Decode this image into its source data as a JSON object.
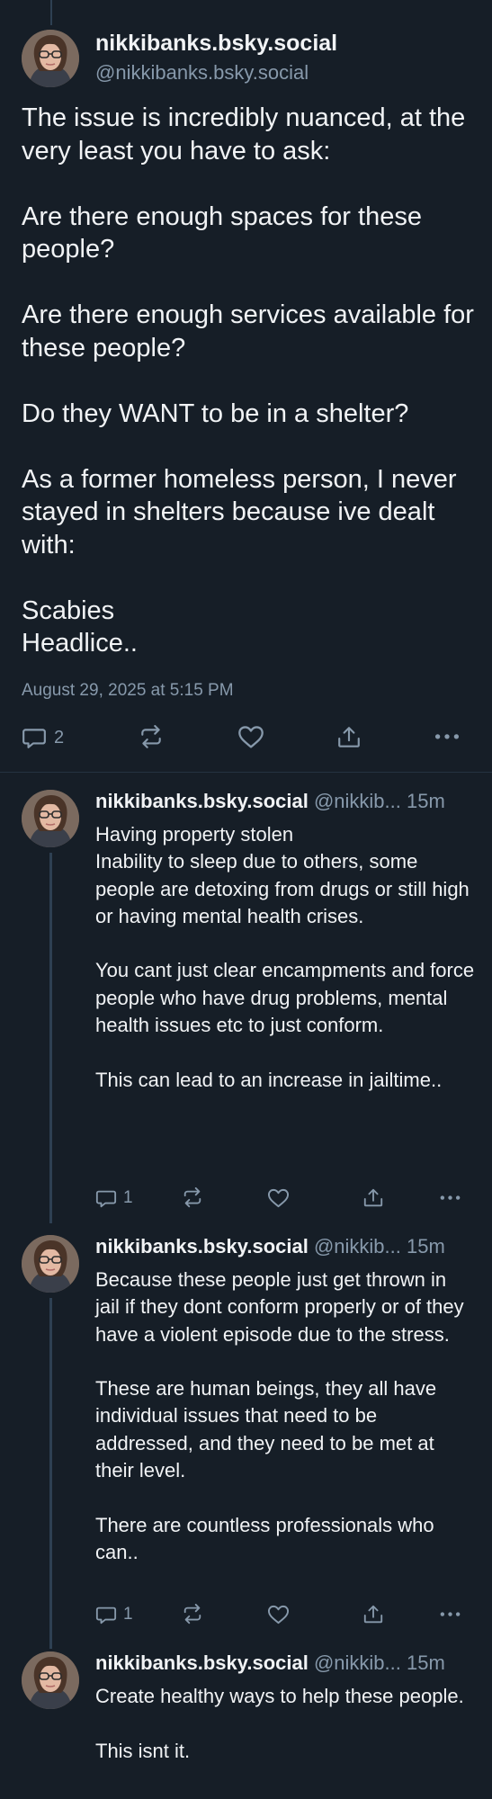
{
  "main_post": {
    "display_name": "nikkibanks.bsky.social",
    "handle": "@nikkibanks.bsky.social",
    "text": "The issue is incredibly nuanced, at the very least you have to ask:\n\nAre there enough spaces for these people?\n\nAre there enough services available for these people?\n\nDo they WANT to be in a shelter?\n\nAs a former homeless person, I never stayed in shelters because ive dealt with:\n\nScabies\nHeadlice..",
    "timestamp": "August 29, 2025 at 5:15 PM",
    "reply_count": "2"
  },
  "replies": [
    {
      "display_name": "nikkibanks.bsky.social",
      "handle": "@nikkib...",
      "time": "15m",
      "text": "Having property stolen\nInability to sleep due to others, some people are detoxing from drugs or still high or having mental health crises.\n\nYou cant just clear encampments and force people who have drug problems, mental health issues etc to just conform.\n\nThis can lead to an increase in jailtime..",
      "reply_count": "1"
    },
    {
      "display_name": "nikkibanks.bsky.social",
      "handle": "@nikkib...",
      "time": "15m",
      "text": "Because these people just get thrown in jail if they dont conform properly or of they have a violent episode due to the stress.\n\nThese are human beings, they all have individual issues that need to be addressed, and they need to be met at their level.\n\nThere are countless professionals who can..",
      "reply_count": "1"
    },
    {
      "display_name": "nikkibanks.bsky.social",
      "handle": "@nikkib...",
      "time": "15m",
      "text": "Create healthy ways to help these people.\n\nThis isnt it."
    }
  ],
  "icons": {
    "reply": "speech-bubble-icon",
    "repost": "repost-icon",
    "like": "heart-icon",
    "share": "share-icon",
    "more": "ellipsis-icon"
  },
  "colors": {
    "background": "#161e27",
    "text": "#f1f3f5",
    "muted": "#8799ab",
    "thread_line": "#2e4052"
  }
}
